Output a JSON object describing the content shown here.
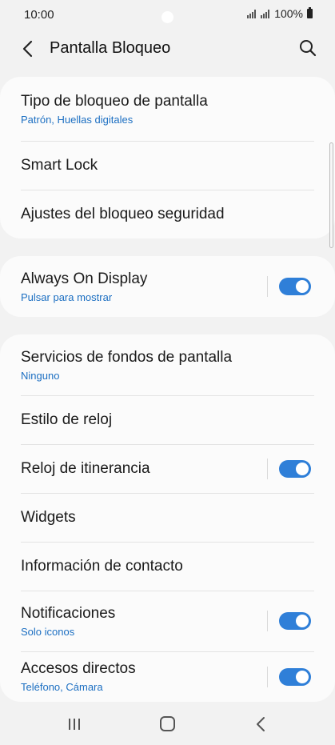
{
  "status_bar": {
    "time": "10:00",
    "battery": "100%"
  },
  "header": {
    "title": "Pantalla Bloqueo"
  },
  "sections": [
    {
      "items": [
        {
          "title": "Tipo de bloqueo de pantalla",
          "subtitle": "Patrón, Huellas digitales"
        },
        {
          "title": "Smart Lock"
        },
        {
          "title": "Ajustes del bloqueo seguridad"
        }
      ]
    },
    {
      "items": [
        {
          "title": "Always On Display",
          "subtitle": "Pulsar para mostrar",
          "toggle": true
        }
      ]
    },
    {
      "items": [
        {
          "title": "Servicios de fondos de pantalla",
          "subtitle": "Ninguno"
        },
        {
          "title": "Estilo de reloj"
        },
        {
          "title": "Reloj de itinerancia",
          "toggle": true
        },
        {
          "title": "Widgets"
        },
        {
          "title": "Información de contacto"
        },
        {
          "title": "Notificaciones",
          "subtitle": "Solo iconos",
          "toggle": true
        },
        {
          "title": "Accesos directos",
          "subtitle": "Teléfono, Cámara",
          "toggle": true
        }
      ]
    }
  ],
  "colors": {
    "accent": "#2f7fd8",
    "subtitle": "#1c6fc2",
    "background": "#f2f2f2",
    "card": "#fbfbfb"
  },
  "icons": {
    "back": "chevron-left-icon",
    "search": "search-icon",
    "nav_recents": "recents-icon",
    "nav_home": "home-icon",
    "nav_back": "back-icon"
  }
}
